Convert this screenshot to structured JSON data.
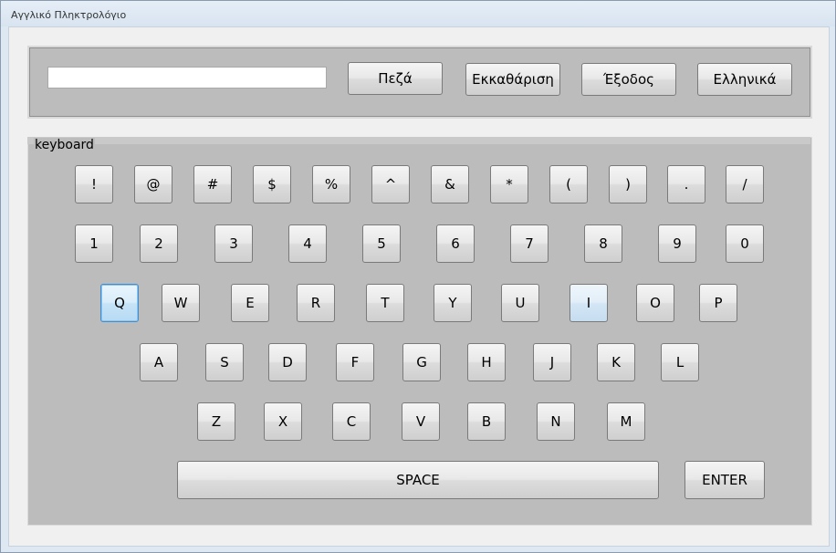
{
  "window": {
    "title": "Αγγλικό Πληκτρολόγιο"
  },
  "input": {
    "value": ""
  },
  "top_buttons": {
    "lower": "Πεζά",
    "clear": "Εκκαθάριση",
    "exit": "Έξοδος",
    "greek": "Ελληνικά"
  },
  "keyboard": {
    "legend": "keyboard",
    "row1": [
      "!",
      "@",
      "#",
      "$",
      "%",
      "^",
      "&",
      "*",
      "(",
      ")",
      ".",
      "/"
    ],
    "row2": [
      "1",
      "2",
      "3",
      "4",
      "5",
      "6",
      "7",
      "8",
      "9",
      "0"
    ],
    "row3": [
      "Q",
      "W",
      "E",
      "R",
      "T",
      "Y",
      "U",
      "I",
      "O",
      "P"
    ],
    "row4": [
      "A",
      "S",
      "D",
      "F",
      "G",
      "H",
      "J",
      "K",
      "L"
    ],
    "row5": [
      "Z",
      "X",
      "C",
      "V",
      "B",
      "N",
      "M"
    ],
    "space": "SPACE",
    "enter": "ENTER"
  }
}
